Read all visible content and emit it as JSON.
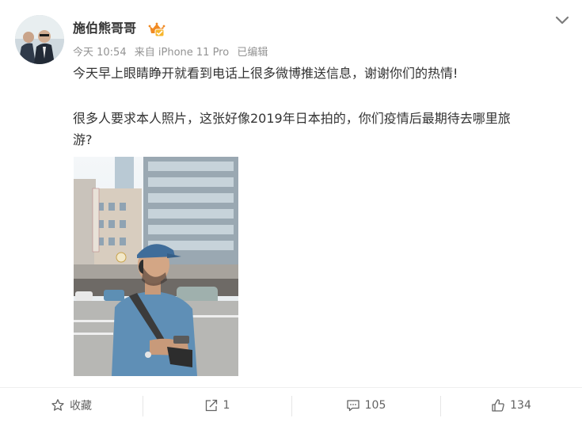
{
  "post": {
    "username": "施伯熊哥哥",
    "meta": {
      "time": "今天 10:54",
      "source": "来自 iPhone 11 Pro",
      "edited": "已编辑"
    },
    "text_line1": "今天早上眼睛睁开就看到电话上很多微博推送信息，谢谢你们的热情!",
    "text_line2": "很多人要求本人照片，这张好像2019年日本拍的，你们疫情后最期待去哪里旅",
    "text_line3": "游?"
  },
  "actions": {
    "favorite_label": "收藏",
    "share_count": "1",
    "comment_count": "105",
    "like_count": "134"
  },
  "icons": {
    "vip": "vip-crown-badge-icon",
    "more": "chevron-down-icon",
    "favorite": "star-outline-icon",
    "share": "share-arrow-icon",
    "comment": "comment-bubble-icon",
    "like": "thumbs-up-icon"
  },
  "colors": {
    "badge_orange": "#f08a24",
    "meta_gray": "#939393",
    "text": "#333333"
  }
}
